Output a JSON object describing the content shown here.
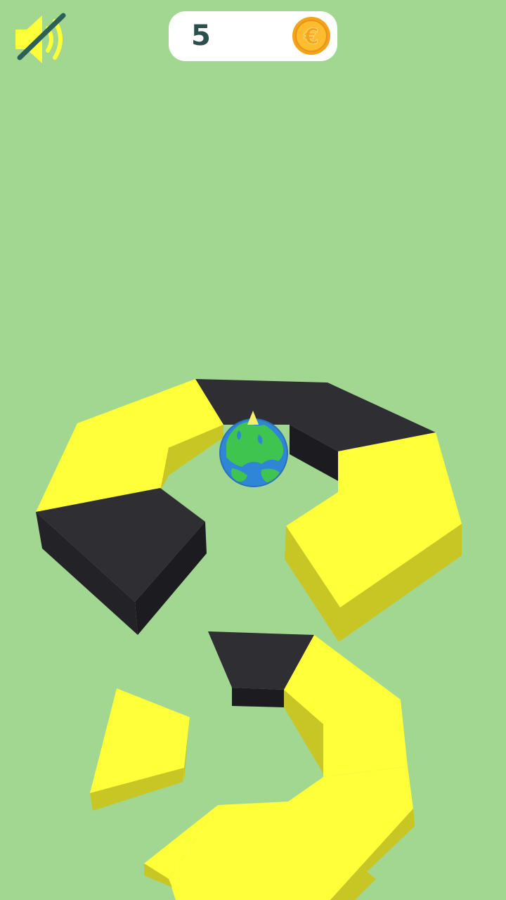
{
  "hud": {
    "coin_count": "5",
    "sound_state": "muted",
    "icons": {
      "sound": "speaker-muted-icon",
      "coin": "euro-coin-icon"
    }
  },
  "colors": {
    "background": "#a2d792",
    "safe_platform_top": "#ffff3a",
    "safe_platform_side": "#c8c624",
    "danger_platform_top": "#2f2e33",
    "danger_platform_side": "#1c1b1f",
    "ball_land": "#3fc44f",
    "ball_ocean": "#2f86d6",
    "coin": "#f5a31a"
  },
  "game": {
    "ball": "earth-ball",
    "rings_visible": 2
  }
}
